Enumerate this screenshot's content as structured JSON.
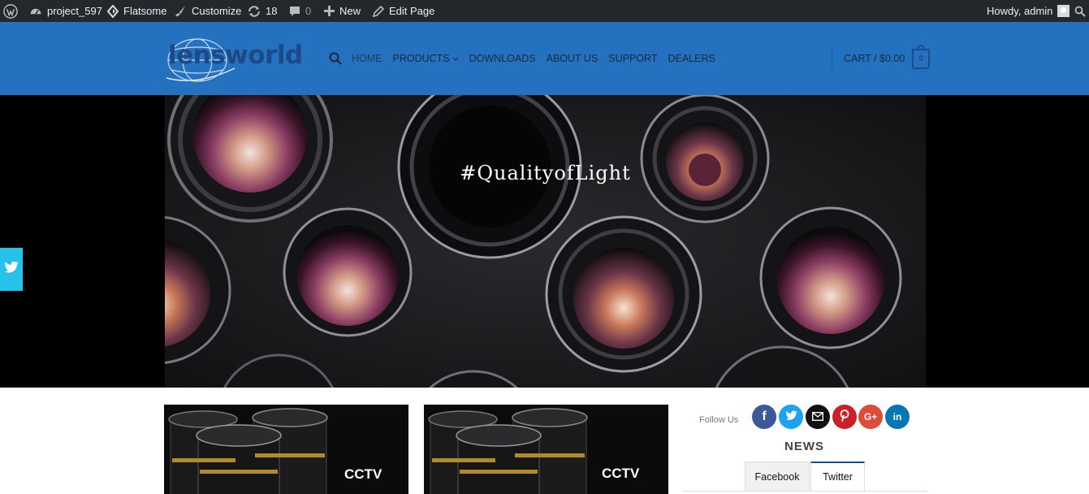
{
  "adminbar": {
    "site_name": "project_597",
    "theme": "Flatsome",
    "customize": "Customize",
    "updates_count": "18",
    "comments_count": "0",
    "new_label": "New",
    "edit_page": "Edit Page",
    "greeting": "Howdy, admin"
  },
  "header": {
    "logo_text": "lensworld",
    "nav": {
      "home": "HOME",
      "products": "PRODUCTS",
      "downloads": "DOWNLOADS",
      "about": "ABOUT US",
      "support": "SUPPORT",
      "dealers": "DEALERS"
    },
    "cart_label": "CART / $0.00",
    "cart_count": "0"
  },
  "hero": {
    "caption": "#QualityofLight"
  },
  "cards": [
    {
      "label": "CCTV"
    },
    {
      "label": "CCTV"
    }
  ],
  "sidebar": {
    "follow_label": "Follow Us",
    "news_title": "NEWS",
    "tabs": {
      "facebook": "Facebook",
      "twitter": "Twitter"
    }
  },
  "colors": {
    "adminbar_bg": "#23282d",
    "header_bg": "#2471bf",
    "twitter_tab": "#27c2ec",
    "facebook": "#3b5998",
    "twitter": "#1da1f2",
    "email": "#111111",
    "pinterest": "#cb2027",
    "googleplus": "#dd4b39",
    "linkedin": "#0077b5"
  },
  "icons": [
    "wordpress-icon",
    "dashboard-icon",
    "flatsome-icon",
    "brush-icon",
    "updates-icon",
    "comment-icon",
    "plus-icon",
    "pencil-icon",
    "search-icon",
    "cart-icon",
    "twitter-icon",
    "facebook-icon",
    "email-icon",
    "pinterest-icon",
    "google-plus-icon",
    "linkedin-icon"
  ]
}
